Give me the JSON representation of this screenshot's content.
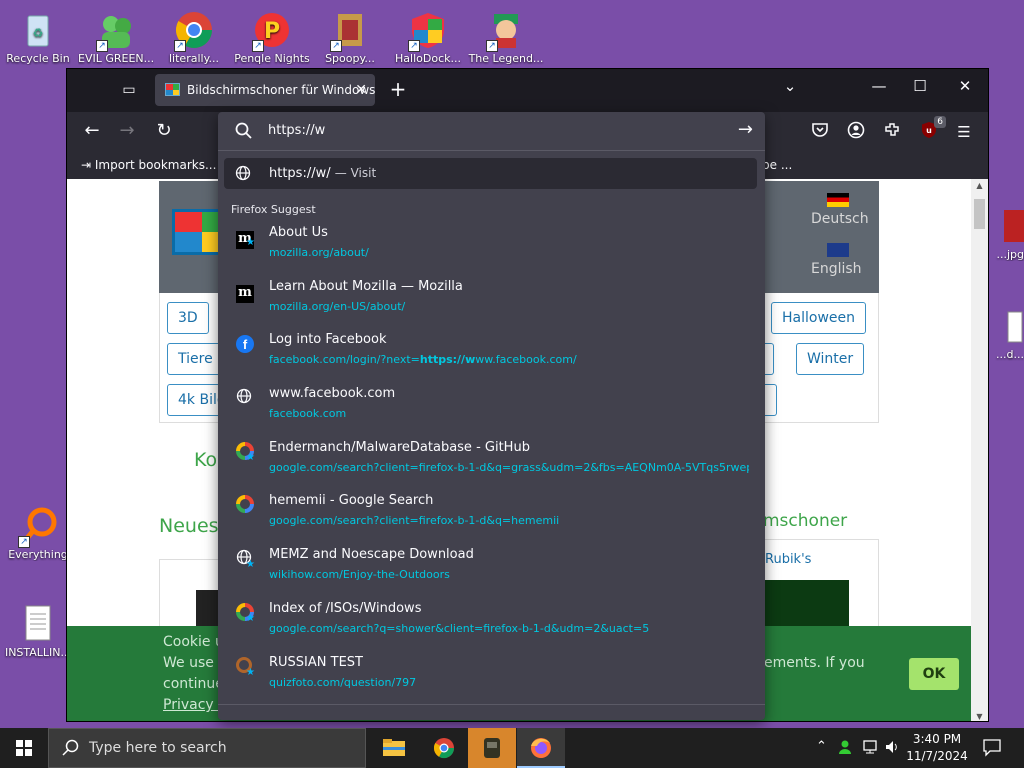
{
  "desktop": {
    "icons": [
      {
        "label": "Recycle Bin",
        "icon": "recycle-bin-icon"
      },
      {
        "label": "EVIL GREEN...",
        "icon": "evil-green-icon"
      },
      {
        "label": "literally...",
        "icon": "chrome-icon"
      },
      {
        "label": "Penqle Nights",
        "icon": "penqle-icon"
      },
      {
        "label": "Spoopy...",
        "icon": "spoopy-icon"
      },
      {
        "label": "HalloDock...",
        "icon": "hallodock-icon"
      },
      {
        "label": "The Legend...",
        "icon": "legend-icon"
      },
      {
        "label": "Everything",
        "icon": "everything-icon"
      },
      {
        "label": "INSTALLIN...",
        "icon": "text-file-icon"
      },
      {
        "label": "...jpg",
        "icon": "image-file-icon"
      },
      {
        "label": "...d...",
        "icon": "file-icon"
      }
    ]
  },
  "browser": {
    "tab": {
      "title": "Bildschirmschoner für Windows"
    },
    "bookmarks": {
      "import_label": "Import bookmarks...",
      "other_label": "pe ..."
    },
    "badge_count": "6"
  },
  "urlbar": {
    "value": "https://w",
    "heuristic": {
      "url": "https://w/",
      "action": "— Visit"
    },
    "section_title": "Firefox Suggest",
    "suggestions": [
      {
        "title": "About Us",
        "url": "mozilla.org/about/",
        "icon": "mozilla-icon",
        "bookmarked": true
      },
      {
        "title": "Learn About Mozilla — Mozilla",
        "url": "mozilla.org/en-US/about/",
        "icon": "mozilla-icon",
        "bookmarked": false
      },
      {
        "title": "Log into Facebook",
        "url_pre": "facebook.com/login/?next=",
        "url_bold": "https://w",
        "url_post": "ww.facebook.com/",
        "icon": "facebook-icon",
        "bookmarked": false
      },
      {
        "title": "www.facebook.com",
        "url": "facebook.com",
        "icon": "globe-icon",
        "bookmarked": false
      },
      {
        "title": "Endermanch/MalwareDatabase - GitHub",
        "url": "google.com/search?client=firefox-b-1-d&q=grass&udm=2&fbs=AEQNm0A-5VTqs5rwepl",
        "icon": "google-icon",
        "bookmarked": true
      },
      {
        "title": "hememii - Google Search",
        "url": "google.com/search?client=firefox-b-1-d&q=hememii",
        "icon": "google-icon",
        "bookmarked": false
      },
      {
        "title": "MEMZ and Noescape Download",
        "url": "wikihow.com/Enjoy-the-Outdoors",
        "icon": "globe-icon",
        "bookmarked": true
      },
      {
        "title": "Index of /ISOs/Windows",
        "url": "google.com/search?q=shower&client=firefox-b-1-d&udm=2&uact=5",
        "icon": "google-icon",
        "bookmarked": true
      },
      {
        "title": "RUSSIAN TEST",
        "url": "quizfoto.com/question/797",
        "icon": "quizfoto-icon",
        "bookmarked": true
      }
    ]
  },
  "page": {
    "languages": [
      "Deutsch",
      "English"
    ],
    "tags_row1": [
      "3D",
      "Halloween"
    ],
    "tags_row2": [
      "Tiere",
      "t",
      "Winter"
    ],
    "tags_row3": [
      "4k Bild"
    ],
    "green_texts": [
      "Ko",
      "Neues",
      "mschoner"
    ],
    "card_label": "Rubik's",
    "cookie_lines": [
      "Cookie u",
      "We use c",
      "continue",
      "Privacy F"
    ],
    "cookie_right": "ements. If you",
    "ok_label": "OK"
  },
  "taskbar": {
    "search_placeholder": "Type here to search",
    "time": "3:40 PM",
    "date": "11/7/2024"
  }
}
